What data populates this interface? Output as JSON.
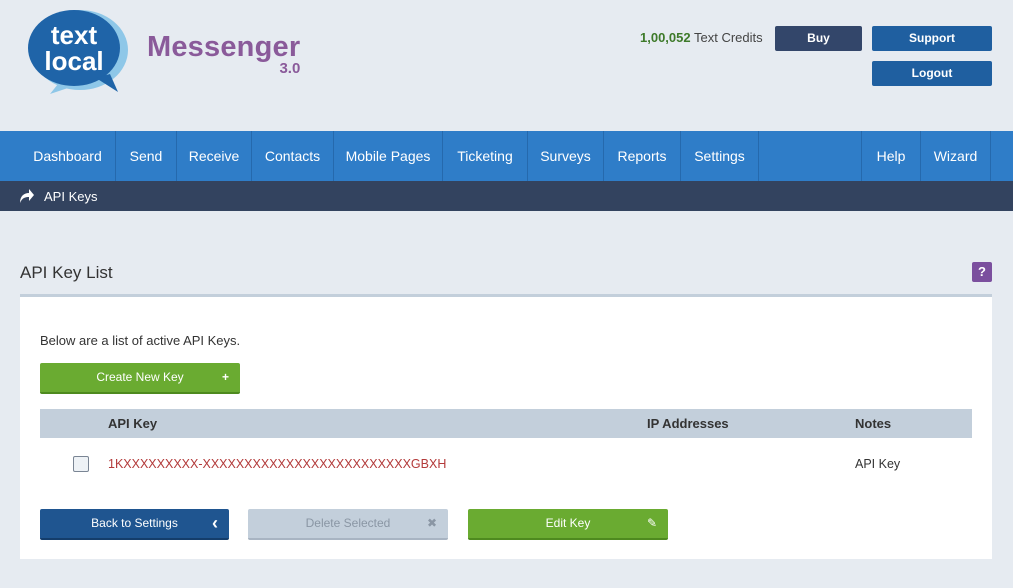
{
  "header": {
    "logo_line1": "text",
    "logo_line2": "local",
    "brand": "Messenger",
    "version": "3.0",
    "credits_value": "1,00,052",
    "credits_label": "Text Credits",
    "buy_label": "Buy",
    "support_label": "Support",
    "logout_label": "Logout"
  },
  "nav": {
    "items": [
      "Dashboard",
      "Send",
      "Receive",
      "Contacts",
      "Mobile Pages",
      "Ticketing",
      "Surveys",
      "Reports",
      "Settings"
    ],
    "right_items": [
      "Help",
      "Wizard"
    ]
  },
  "breadcrumb": {
    "icon": "share-arrow-icon",
    "label": "API Keys"
  },
  "section": {
    "title": "API Key List",
    "help": "?"
  },
  "content": {
    "intro": "Below are a list of active API Keys.",
    "create_label": "Create New Key",
    "create_glyph": "+",
    "table": {
      "headers": [
        "API Key",
        "IP Addresses",
        "Notes"
      ],
      "rows": [
        {
          "api_key": "1KXXXXXXXXX-XXXXXXXXXXXXXXXXXXXXXXXXXGBXH",
          "ip_addresses": "",
          "notes": "API Key",
          "checked": false
        }
      ]
    },
    "back_label": "Back to Settings",
    "back_glyph": "‹",
    "delete_label": "Delete Selected",
    "delete_glyph": "✖",
    "edit_label": "Edit Key",
    "edit_glyph": "✎"
  },
  "colors": {
    "nav": "#2f7dc8",
    "breadcrumb": "#33435f",
    "accent_green": "#6aab31",
    "brand_purple": "#8a5a9a"
  }
}
